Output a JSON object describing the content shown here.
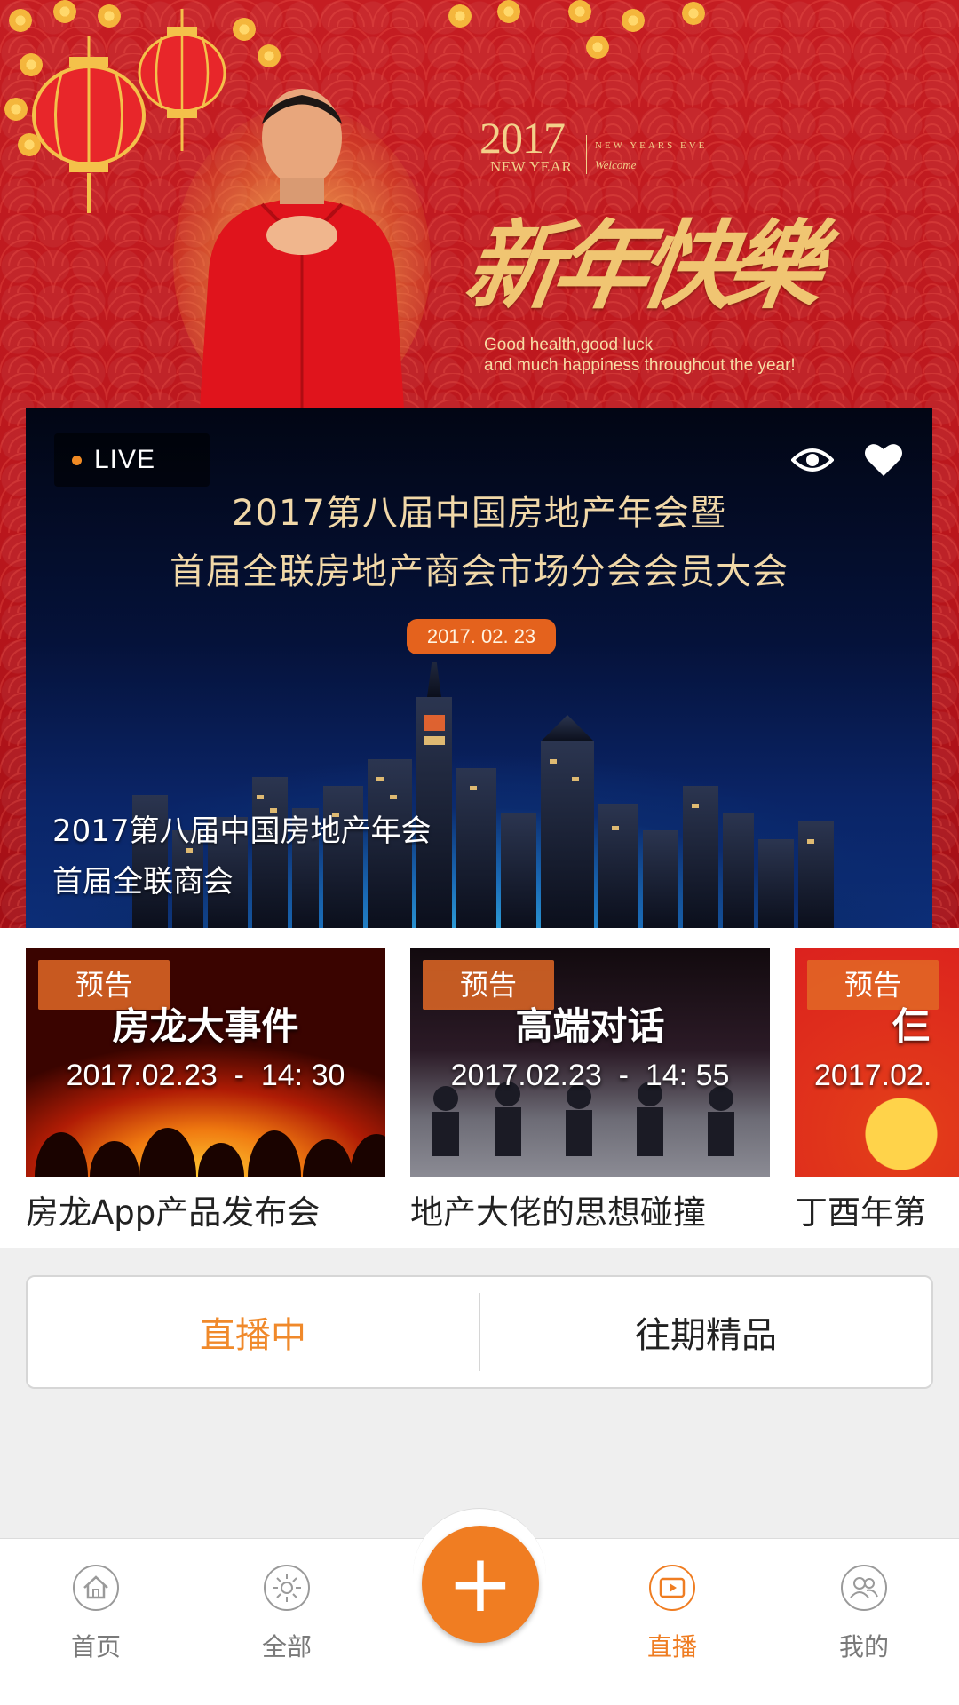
{
  "banner": {
    "year": "2017",
    "new_year": "NEW YEAR",
    "new_years_eve": "NEW YEARS EVE",
    "welcome": "Welcome",
    "calligraphy": "新年快樂",
    "wishes_line1": "Good health,good luck",
    "wishes_line2": "and much happiness throughout the year!"
  },
  "live_card": {
    "badge": "LIVE",
    "title_line1": "2017第八届中国房地产年会暨",
    "title_line2": "首届全联房地产商会市场分会会员大会",
    "date": "2017. 02. 23",
    "caption_line1": "2017第八届中国房地产年会",
    "caption_line2": "首届全联商会",
    "icons": [
      "eye-icon",
      "heart-icon"
    ]
  },
  "previews": [
    {
      "tag": "预告",
      "headline": "房龙大事件",
      "time": "2017.02.23  -  14: 30",
      "label": "房龙App产品发布会"
    },
    {
      "tag": "预告",
      "headline": "高端对话",
      "time": "2017.02.23  -  14: 55",
      "label": "地产大佬的思想碰撞"
    },
    {
      "tag": "预告",
      "headline": "仨",
      "time": "2017.02.",
      "label": "丁酉年第"
    }
  ],
  "segmented": {
    "live": "直播中",
    "past": "往期精品"
  },
  "tabbar": {
    "home": "首页",
    "all": "全部",
    "add": "+",
    "live": "直播",
    "mine": "我的"
  },
  "colors": {
    "accent": "#f07d22",
    "banner_red": "#c51d22",
    "gold": "#f0c572"
  }
}
